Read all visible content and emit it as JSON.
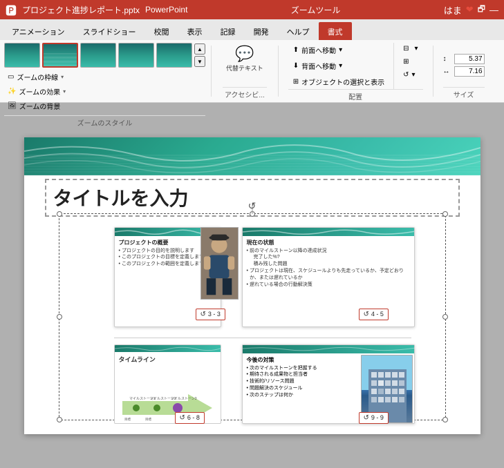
{
  "titlebar": {
    "filename": "プロジェクト進捗レポート.pptx",
    "app": "PowerPoint",
    "zoom_tools": "ズームツール",
    "user": "はま",
    "close": "—"
  },
  "ribbon": {
    "tabs": [
      "アニメーション",
      "スライドショー",
      "校閲",
      "表示",
      "記録",
      "開発",
      "ヘルプ",
      "書式"
    ],
    "active_tab": "書式",
    "groups": {
      "zoom_style": {
        "label": "ズームのスタイル",
        "dropdown_items": [
          "ズームの枠線",
          "ズームの効果",
          "ズームの背景"
        ]
      },
      "accessibility": {
        "label": "アクセシビ...",
        "alt_text": "代替テキスト"
      },
      "arrange": {
        "label": "配置",
        "items": [
          "前面へ移動",
          "背面へ移動",
          "オブジェクトの選択と表示"
        ]
      },
      "size": {
        "label": "サイズ",
        "width": "5.37",
        "height": "7.16"
      }
    }
  },
  "slide": {
    "title": "タイトルを入力",
    "zoom_cards": [
      {
        "id": "card1",
        "title": "プロジェクトの概要",
        "bullets": [
          "プロジェクトの目的を説明します",
          "このプロジェクトの目標を定義します",
          "このプロジェクトの範囲を定義します"
        ],
        "badge": "3 - 3"
      },
      {
        "id": "card2",
        "title": "現在の状態",
        "bullets": [
          "前のマイルストーン以降の達成状況",
          "完了した%?",
          "積み残した問題",
          "プロジェクトは現在、スケジュールよりも先走っているか、予定どおりか、または遅れているか",
          "遅れている場合の行動解決策"
        ],
        "badge": "4 - 5"
      },
      {
        "id": "card3",
        "title": "タイムライン",
        "badge": "6 - 8"
      },
      {
        "id": "card4",
        "title": "今後の対策",
        "bullets": [
          "次のマイルストーンを把握する",
          "期待される成果物と担当者",
          "技術的/リソース問題",
          "問題解決のスケジュール",
          "次のステップは何か"
        ],
        "badge": "9 - 9"
      }
    ]
  },
  "icons": {
    "rotate": "↺",
    "badge_icon": "↺",
    "dropdown_arrow": "▾",
    "window_min": "—",
    "window_max": "□",
    "window_close": "✕",
    "forward": "▶",
    "back": "◀",
    "help": "💡",
    "search": "🔍",
    "heart": "❤"
  }
}
